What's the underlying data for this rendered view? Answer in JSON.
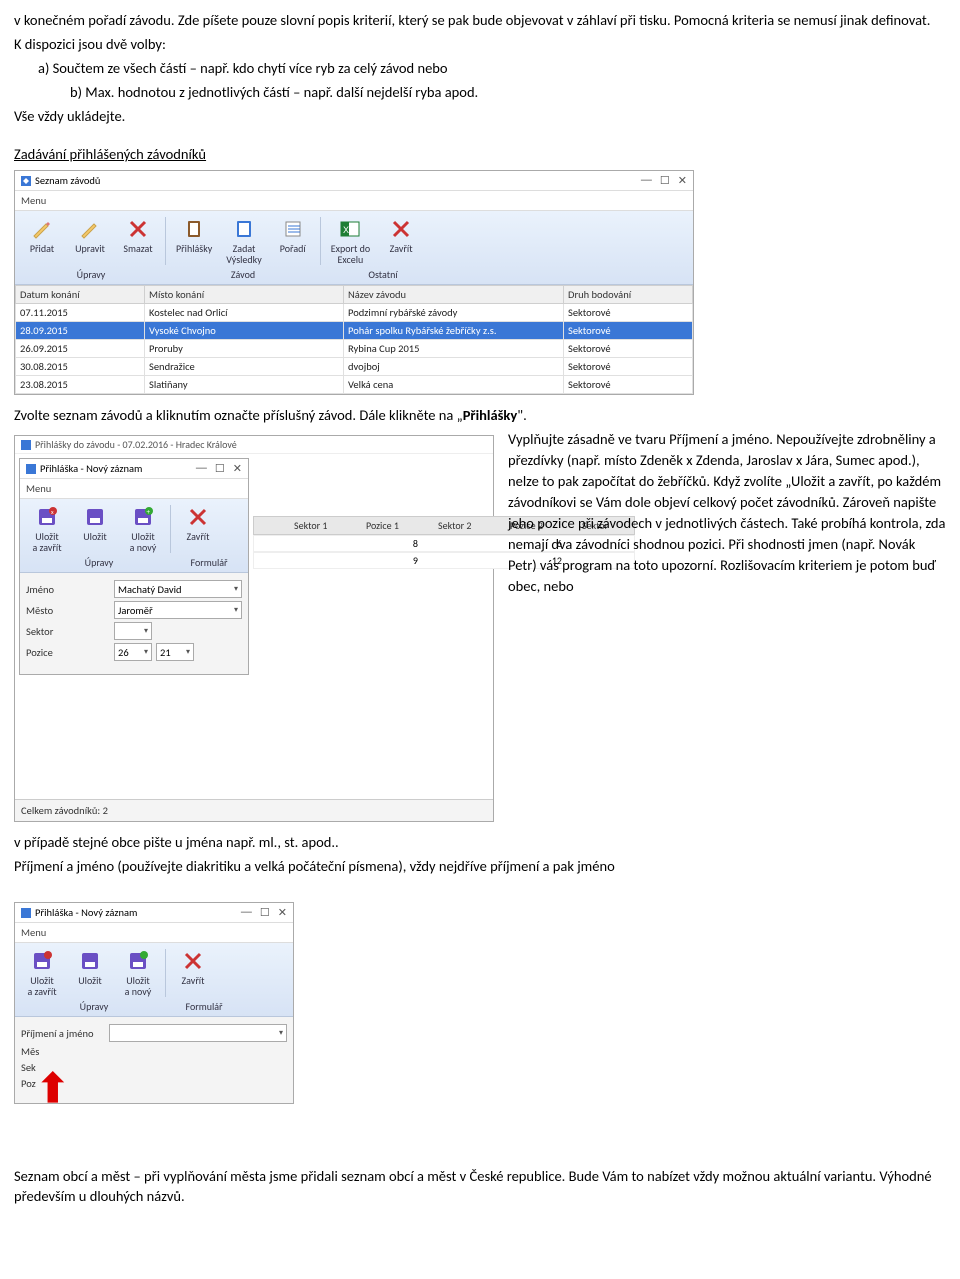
{
  "intro": {
    "p1": "v konečném pořadí závodu. Zde píšete pouze slovní popis kriterií, který se pak bude objevovat v záhlaví při tisku. Pomocná kriteria se nemusí jinak definovat.",
    "p2": "K dispozici jsou dvě volby:",
    "opt_a": "a)   Součtem ze všech částí – např. kdo chytí více ryb za celý závod  nebo",
    "opt_b": "b)   Max. hodnotou z jednotlivých částí – např. další nejdelší ryba apod.",
    "p3": "Vše vždy ukládejte.",
    "heading": "Zadávání přihlášených závodníků"
  },
  "shot1": {
    "title": "Seznam závodů",
    "menu": "Menu",
    "buttons": {
      "pridat": "Přidat",
      "upravit": "Upravit",
      "smazat": "Smazat",
      "prihlasky": "Přihlášky",
      "zadat": "Zadat\nVýsledky",
      "poradi": "Pořadí",
      "export": "Export do\nExcelu",
      "zavrit": "Zavřít"
    },
    "groups": {
      "upravy": "Úpravy",
      "zavod": "Závod",
      "ostatni": "Ostatní"
    },
    "headers": {
      "datum": "Datum konání",
      "misto": "Místo konání",
      "nazev": "Název závodu",
      "druh": "Druh bodování"
    },
    "rows": [
      {
        "datum": "07.11.2015",
        "misto": "Kostelec nad Orlicí",
        "nazev": "Podzimní rybářské závody",
        "druh": "Sektorové"
      },
      {
        "datum": "28.09.2015",
        "misto": "Vysoké Chvojno",
        "nazev": "Pohár spolku Rybářské žebříčky z.s.",
        "druh": "Sektorové",
        "selected": true
      },
      {
        "datum": "26.09.2015",
        "misto": "Proruby",
        "nazev": "Rybina Cup 2015",
        "druh": "Sektorové"
      },
      {
        "datum": "30.08.2015",
        "misto": "Sendražice",
        "nazev": "dvojboj",
        "druh": "Sektorové"
      },
      {
        "datum": "23.08.2015",
        "misto": "Slatiňany",
        "nazev": "Velká cena",
        "druh": "Sektorové"
      }
    ]
  },
  "mid_text": {
    "line": "Zvolte seznam závodů a kliknutím označte příslušný závod. Dále klikněte na „",
    "bold": "Přihlášky",
    "line_end": "\".",
    "right": "Vyplňujte zásadně ve tvaru Příjmení a jméno. Nepoužívejte zdrobněliny a přezdívky (např. místo Zdeněk x Zdenda, Jaroslav x Jára, Sumec apod.), nelze to pak započítat do žebříčků. Když zvolíte „Uložit a zavřít, po každém závodníkovi se Vám dole objeví celkový počet závodníků. Zároveň napište jeho pozice při závodech v jednotlivých částech. Také probíhá kontrola, zda nemají dva závodníci shodnou pozici. Při shodnosti jmen (např. Novák Petr) vás program na toto upozorní. Rozlišovacím kriteriem je potom buď obec, nebo",
    "after": "v případě stejné obce pište u jména např. ml., st. apod..",
    "after2": "Příjmení a jméno (používejte diakritiku a velká počáteční písmena), vždy nejdříve příjmení a pak jméno"
  },
  "shot2": {
    "outer_title": "Přihlášky do závodu - 07.02.2016 - Hradec Králové",
    "title": "Přihláška - Nový záznam",
    "menu": "Menu",
    "buttons": {
      "uz_zavrit": "Uložit\na zavřít",
      "ulozit": "Uložit",
      "uz_novy": "Uložit\na nový",
      "zavrit": "Zavřít"
    },
    "groups": {
      "upravy": "Úpravy",
      "formular": "Formulář"
    },
    "labels": {
      "jmeno": "Jméno",
      "mesto": "Město",
      "sektor": "Sektor",
      "pozice": "Pozice"
    },
    "values": {
      "jmeno": "Machatý David",
      "mesto": "Jaroměř",
      "sektor": "",
      "p1": "26",
      "p2": "21"
    },
    "sectors_head": [
      "Sektor 1",
      "Pozice 1",
      "Sektor 2",
      "Pozice 2",
      "Sektor"
    ],
    "sectors_rows": [
      [
        "",
        "8",
        "",
        "6",
        ""
      ],
      [
        "",
        "9",
        "",
        "12",
        ""
      ]
    ],
    "status": "Celkem závodníků: 2"
  },
  "shot3": {
    "title": "Přihláška - Nový záznam",
    "menu": "Menu",
    "buttons": {
      "uz_zavrit": "Uložit\na zavřít",
      "ulozit": "Uložit",
      "uz_novy": "Uložit\na nový",
      "zavrit": "Zavřít"
    },
    "groups": {
      "upravy": "Úpravy",
      "formular": "Formulář"
    },
    "labels": {
      "prijmeni": "Příjmení a jméno",
      "mes": "Měs",
      "sek": "Sek",
      "poz": "Poz"
    }
  },
  "bottom": {
    "p1": "Seznam obcí a měst – při vyplňování města jsme přidali seznam obcí a měst v České republice. Bude Vám to nabízet vždy možnou aktuální variantu. Výhodné především u dlouhých názvů."
  }
}
